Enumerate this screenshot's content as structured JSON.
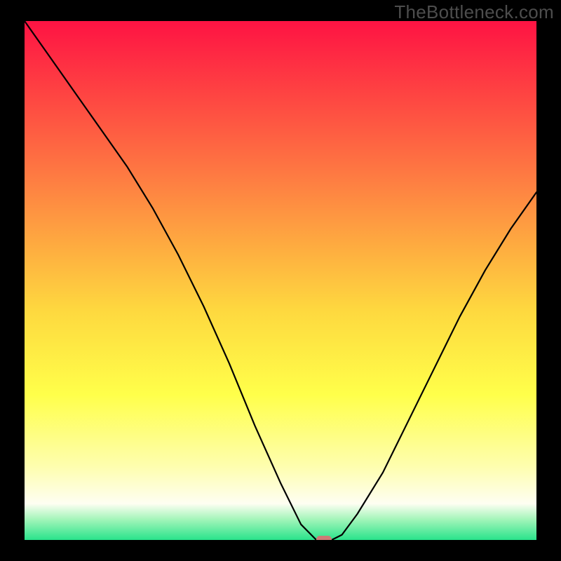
{
  "watermark": {
    "text": "TheBottleneck.com"
  },
  "colors": {
    "bg": "#000000",
    "watermark": "#4d4d4d",
    "curve": "#000000",
    "marker": "#cd7b76",
    "grad_top": "#fe1343",
    "grad_mid1": "#fe7442",
    "grad_mid2": "#fed93f",
    "grad_mid3": "#ffff4a",
    "grad_pale": "#fefeb0",
    "grad_mint": "#a4f5ba",
    "grad_green": "#29e38b"
  },
  "chart_data": {
    "type": "line",
    "title": "",
    "xlabel": "",
    "ylabel": "",
    "xlim": [
      0,
      100
    ],
    "ylim": [
      0,
      100
    ],
    "series": [
      {
        "name": "bottleneck-curve",
        "x": [
          0,
          5,
          10,
          15,
          20,
          25,
          30,
          35,
          40,
          45,
          50,
          54,
          57,
          60,
          62,
          65,
          70,
          75,
          80,
          85,
          90,
          95,
          100
        ],
        "y": [
          100,
          93,
          86,
          79,
          72,
          64,
          55,
          45,
          34,
          22,
          11,
          3,
          0,
          0,
          1,
          5,
          13,
          23,
          33,
          43,
          52,
          60,
          67
        ]
      }
    ],
    "marker": {
      "x": 58.5,
      "y": 0
    },
    "gradient_bands_pct_from_top": [
      {
        "stop": 0,
        "color": "#fe1343"
      },
      {
        "stop": 28,
        "color": "#fe7442"
      },
      {
        "stop": 56,
        "color": "#fed93f"
      },
      {
        "stop": 72,
        "color": "#ffff4a"
      },
      {
        "stop": 86,
        "color": "#fefeb0"
      },
      {
        "stop": 93,
        "color": "#fefef2"
      },
      {
        "stop": 96,
        "color": "#a4f5ba"
      },
      {
        "stop": 100,
        "color": "#29e38b"
      }
    ]
  }
}
